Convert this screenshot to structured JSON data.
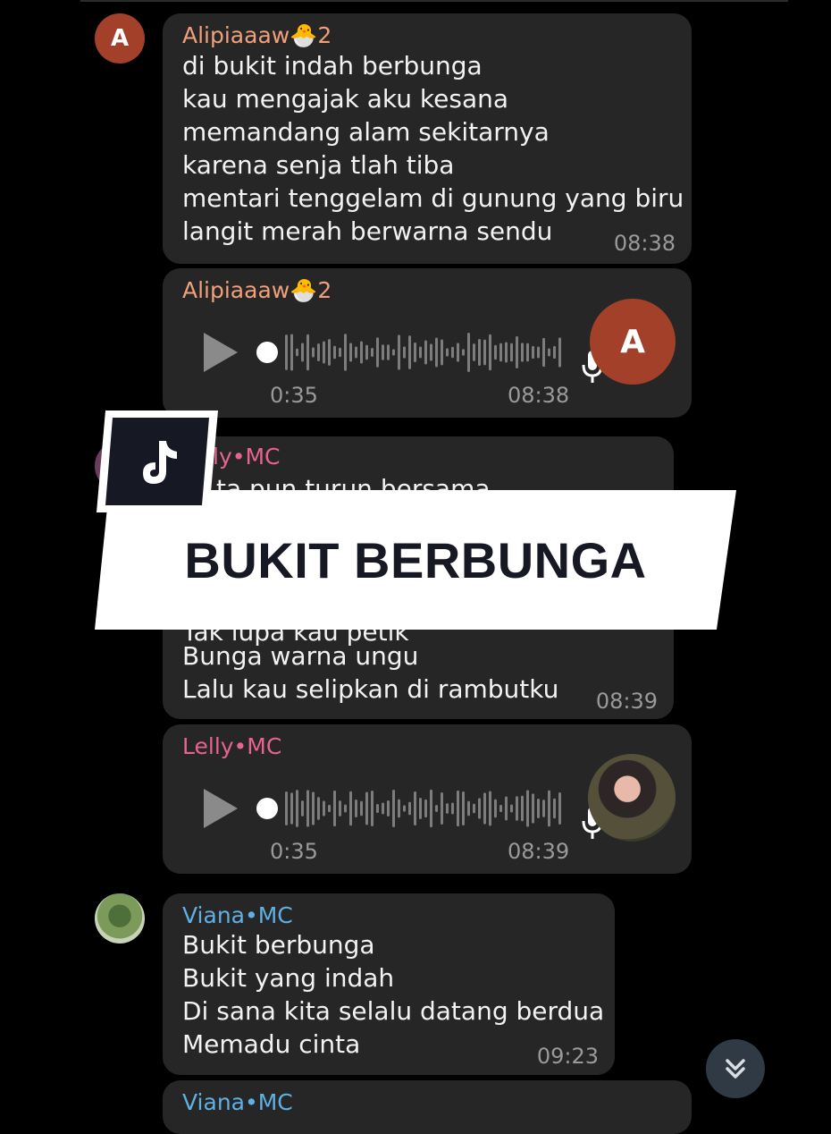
{
  "colors": {
    "bubble": "#262626",
    "name_alipia": "#f0a07a",
    "name_lelly": "#e8638f",
    "name_viana": "#5fb0e4",
    "avatar_alipia": "#a3402a"
  },
  "messages": [
    {
      "sender": "Alipiaaaw🐣2",
      "avatar_letter": "A",
      "lines": [
        "di bukit indah berbunga",
        "kau mengajak aku kesana",
        "memandang alam sekitarnya",
        "karena senja tlah tiba",
        "mentari tenggelam di gunung yang biru",
        "langit merah berwarna sendu"
      ],
      "time": "08:38"
    },
    {
      "sender": "Alipiaaaw🐣2",
      "avatar_letter": "A",
      "voice_duration": "0:35",
      "time": "08:38"
    },
    {
      "sender_visible": "ly•MC",
      "line_partial": "ta pun turun bersama",
      "line_partial2": "Tak lupa kau petik",
      "lines": [
        "Bunga warna ungu",
        "Lalu kau selipkan di rambutku"
      ],
      "time": "08:39"
    },
    {
      "sender": "Lelly•MC",
      "voice_duration": "0:35",
      "time": "08:39"
    },
    {
      "sender": "Viana•MC",
      "lines": [
        "Bukit berbunga",
        "Bukit yang indah",
        "Di sana kita selalu datang berdua",
        "Memadu cinta"
      ],
      "time": "09:23"
    },
    {
      "sender": "Viana•MC"
    }
  ],
  "overlay": {
    "title": "BUKIT BERBUNGA",
    "logo": "tiktok-logo"
  },
  "icons": {
    "play": "play-icon",
    "mic": "mic-icon",
    "scroll": "double-chevron-down-icon"
  }
}
